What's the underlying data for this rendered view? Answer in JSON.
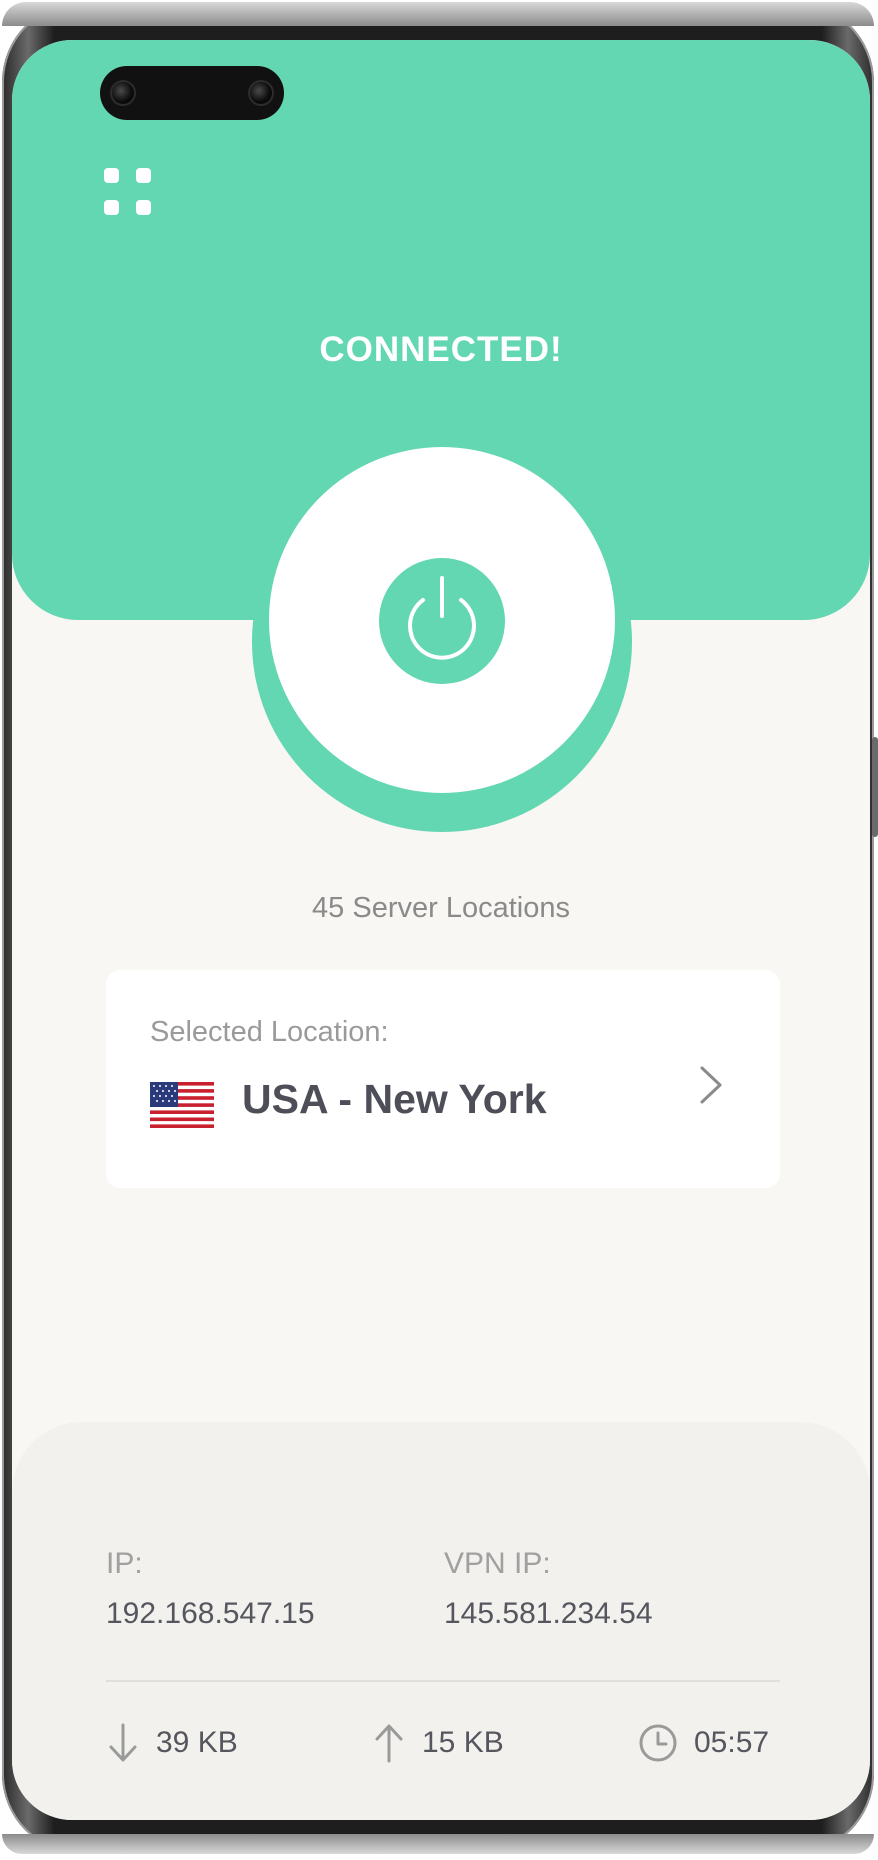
{
  "app": {
    "status": "CONNECTED!",
    "server_count": "45 Server Locations",
    "menu_icon": "grid-menu-icon",
    "power_icon": "power-icon",
    "accent_color": "#63d6b2"
  },
  "location": {
    "label": "Selected Location:",
    "name": "USA - New York",
    "flag_icon": "us-flag-icon",
    "chevron_icon": "chevron-right-icon"
  },
  "network": {
    "ip_label": "IP:",
    "ip_value": "192.168.547.15",
    "vpn_ip_label": "VPN IP:",
    "vpn_ip_value": "145.581.234.54"
  },
  "metrics": {
    "download": "39 KB",
    "upload": "15 KB",
    "duration": "05:57",
    "download_icon": "arrow-down-icon",
    "upload_icon": "arrow-up-icon",
    "clock_icon": "clock-icon"
  }
}
